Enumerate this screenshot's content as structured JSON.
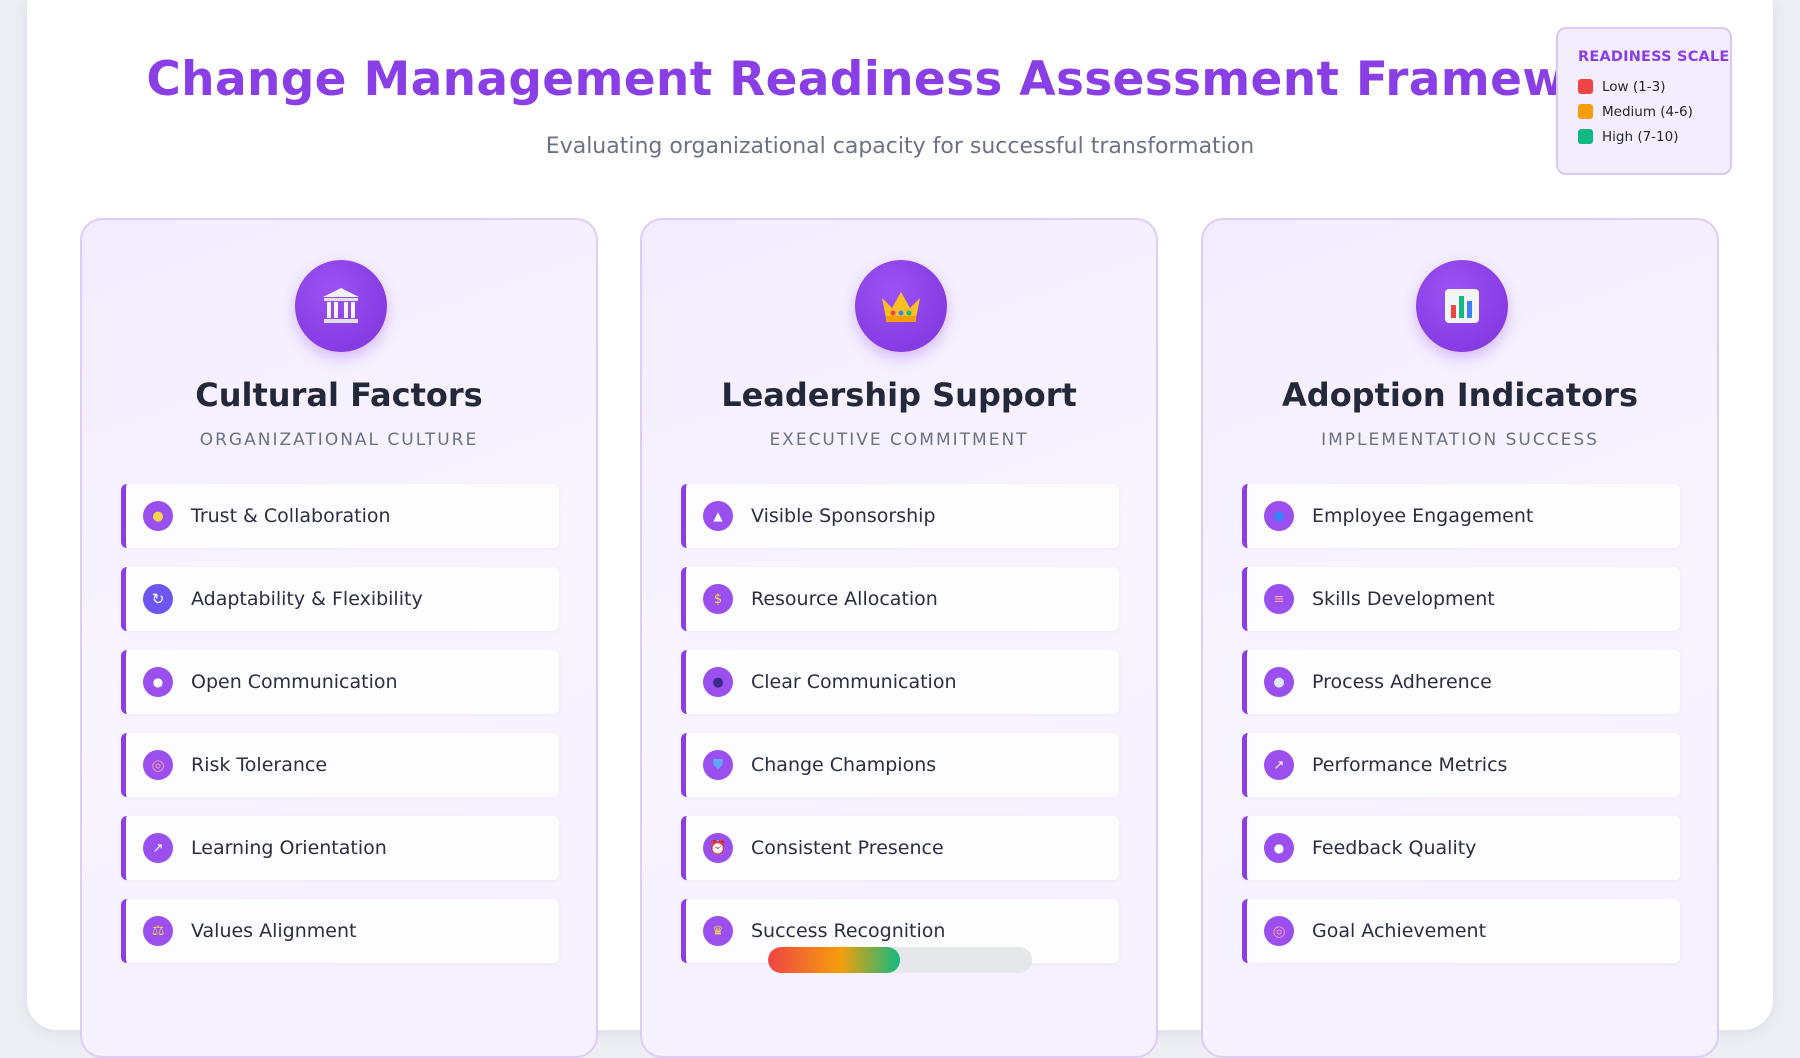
{
  "header": {
    "title": "Change Management Readiness Assessment Framework",
    "subtitle": "Evaluating organizational capacity for successful transformation"
  },
  "legend": {
    "title": "READINESS SCALE",
    "items": [
      {
        "label": "Low (1-3)",
        "color": "#ef4444"
      },
      {
        "label": "Medium (4-6)",
        "color": "#f59e0b"
      },
      {
        "label": "High (7-10)",
        "color": "#10b981"
      }
    ]
  },
  "columns": [
    {
      "icon": "classical-building-icon",
      "title": "Cultural Factors",
      "subtitle": "ORGANIZATIONAL CULTURE",
      "items": [
        {
          "label": "Trust & Collaboration",
          "icon": "handshake-icon"
        },
        {
          "label": "Adaptability & Flexibility",
          "icon": "refresh-icon"
        },
        {
          "label": "Open Communication",
          "icon": "speech-bubble-icon"
        },
        {
          "label": "Risk Tolerance",
          "icon": "target-icon"
        },
        {
          "label": "Learning Orientation",
          "icon": "trend-chart-icon"
        },
        {
          "label": "Values Alignment",
          "icon": "balance-scale-icon"
        }
      ]
    },
    {
      "icon": "crown-icon",
      "title": "Leadership Support",
      "subtitle": "EXECUTIVE COMMITMENT",
      "items": [
        {
          "label": "Visible Sponsorship",
          "icon": "tent-icon"
        },
        {
          "label": "Resource Allocation",
          "icon": "money-bag-icon"
        },
        {
          "label": "Clear Communication",
          "icon": "speaking-head-icon"
        },
        {
          "label": "Change Champions",
          "icon": "shield-icon"
        },
        {
          "label": "Consistent Presence",
          "icon": "alarm-clock-icon"
        },
        {
          "label": "Success Recognition",
          "icon": "trophy-icon"
        }
      ],
      "progress": 0.5
    },
    {
      "icon": "bar-chart-icon",
      "title": "Adoption Indicators",
      "subtitle": "IMPLEMENTATION SUCCESS",
      "items": [
        {
          "label": "Employee Engagement",
          "icon": "people-icon"
        },
        {
          "label": "Skills Development",
          "icon": "books-icon"
        },
        {
          "label": "Process Adherence",
          "icon": "magnifier-icon"
        },
        {
          "label": "Performance Metrics",
          "icon": "trend-chart-icon"
        },
        {
          "label": "Feedback Quality",
          "icon": "speech-bubble-icon"
        },
        {
          "label": "Goal Achievement",
          "icon": "target-icon"
        }
      ]
    }
  ]
}
